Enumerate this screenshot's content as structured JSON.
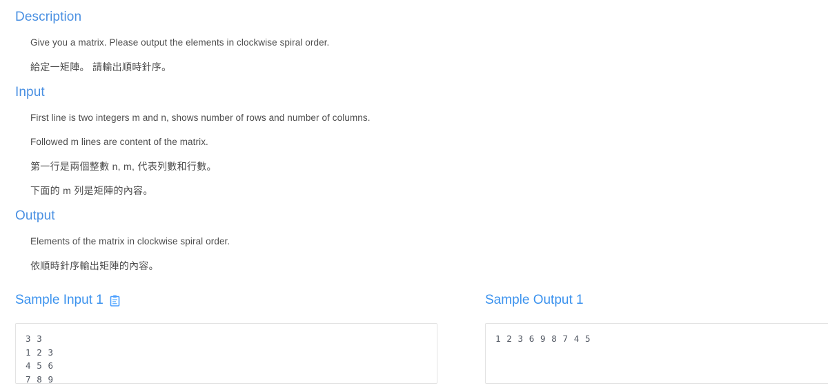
{
  "sections": {
    "description": {
      "heading": "Description",
      "paragraphs": [
        "Give you a matrix. Please output the elements in clockwise spiral order.",
        "給定一矩陣。 請輸出順時針序。"
      ]
    },
    "input": {
      "heading": "Input",
      "paragraphs": [
        "First line is two integers m and n, shows number of rows and number of columns.",
        "Followed m lines are content of the matrix.",
        "第一行是兩個整數 n, m, 代表列數和行數。",
        "下面的 m 列是矩陣的內容。"
      ]
    },
    "output": {
      "heading": "Output",
      "paragraphs": [
        "Elements of the matrix in clockwise spiral order.",
        "依順時針序輸出矩陣的內容。"
      ]
    }
  },
  "samples": {
    "input": {
      "heading": "Sample Input 1",
      "copy_icon": "clipboard-copy-icon",
      "content": "3 3\n1 2 3\n4 5 6\n7 8 9"
    },
    "output": {
      "heading": "Sample Output 1",
      "content": "1 2 3 6 9 8 7 4 5"
    }
  },
  "colors": {
    "heading_blue": "#4a90e2",
    "sample_heading_blue": "#3b92ee",
    "body_text": "#4d4d4d",
    "code_text": "#4f5560",
    "box_border": "#e3e3e3",
    "icon_blue": "#4a9eff",
    "background": "#ffffff"
  }
}
